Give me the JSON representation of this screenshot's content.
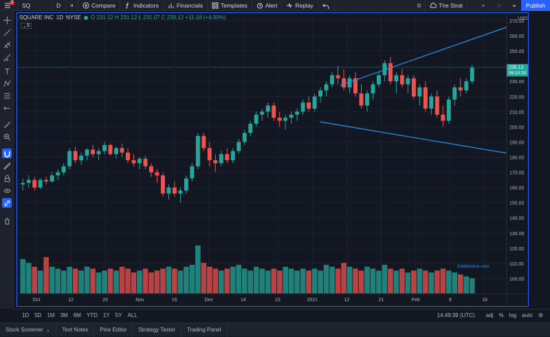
{
  "toolbar": {
    "symbol": "SQ",
    "interval": "D",
    "compare": "Compare",
    "indicators": "Indicators",
    "financials": "Financials",
    "templates": "Templates",
    "alert": "Alert",
    "replay": "Replay",
    "layout_name": "The Strat",
    "publish": "Publish",
    "notification_count": "7"
  },
  "legend": {
    "title": "SQUARE INC",
    "interval": "1D",
    "exchange": "NYSE",
    "ohlc": "O 231.12 H 231.12 L 231.07 C 239.12 +11.18 (+4.90%)",
    "collapsed_label": "S"
  },
  "price_axis": {
    "currency": "USD",
    "ticks": [
      "270.00",
      "260.00",
      "250.00",
      "240.00",
      "230.00",
      "220.00",
      "210.00",
      "200.00",
      "190.00",
      "180.00",
      "170.00",
      "160.00",
      "150.00",
      "140.00",
      "130.00",
      "120.00",
      "110.00",
      "100.00"
    ],
    "last_price": "239.12",
    "countdown": "06:10:20"
  },
  "time_axis": {
    "ticks": [
      "Oct",
      "12",
      "20",
      "Nov",
      "16",
      "Dec",
      "14",
      "22",
      "2021",
      "12",
      "21",
      "Feb",
      "9",
      "18"
    ]
  },
  "watermark": "Criddelsine.com",
  "bottom": {
    "timeframes": [
      "1D",
      "5D",
      "1M",
      "3M",
      "6M",
      "YTD",
      "1Y",
      "5Y",
      "ALL"
    ],
    "clock": "14:49:39 (UTC)",
    "adj": "adj",
    "percent": "%",
    "log": "log",
    "auto": "auto"
  },
  "tabs": [
    "Stock Screener",
    "Text Notes",
    "Pine Editor",
    "Strategy Tester",
    "Trading Panel"
  ],
  "colors": {
    "up": "#26a69a",
    "down": "#ef5350",
    "trendline": "#2196f3",
    "accent": "#2962ff"
  },
  "chart_data": {
    "type": "candlestick",
    "ylim": [
      90,
      275
    ],
    "candles": [
      [
        162,
        166,
        158,
        163
      ],
      [
        163,
        168,
        160,
        165
      ],
      [
        165,
        167,
        158,
        160
      ],
      [
        160,
        166,
        159,
        165
      ],
      [
        165,
        167,
        162,
        164
      ],
      [
        164,
        170,
        163,
        168
      ],
      [
        168,
        172,
        165,
        170
      ],
      [
        170,
        176,
        168,
        174
      ],
      [
        174,
        186,
        172,
        184
      ],
      [
        184,
        187,
        176,
        178
      ],
      [
        178,
        183,
        175,
        181
      ],
      [
        181,
        186,
        178,
        185
      ],
      [
        185,
        188,
        180,
        182
      ],
      [
        182,
        186,
        178,
        184
      ],
      [
        184,
        190,
        182,
        188
      ],
      [
        188,
        189,
        181,
        182
      ],
      [
        182,
        187,
        179,
        186
      ],
      [
        186,
        189,
        180,
        183
      ],
      [
        183,
        186,
        176,
        178
      ],
      [
        178,
        182,
        174,
        176
      ],
      [
        176,
        180,
        172,
        179
      ],
      [
        179,
        181,
        172,
        174
      ],
      [
        174,
        176,
        167,
        170
      ],
      [
        170,
        172,
        163,
        168
      ],
      [
        168,
        170,
        154,
        156
      ],
      [
        156,
        162,
        152,
        160
      ],
      [
        160,
        164,
        154,
        156
      ],
      [
        156,
        160,
        150,
        158
      ],
      [
        158,
        168,
        156,
        166
      ],
      [
        166,
        176,
        164,
        174
      ],
      [
        174,
        196,
        172,
        194
      ],
      [
        194,
        196,
        184,
        186
      ],
      [
        186,
        190,
        174,
        178
      ],
      [
        178,
        182,
        170,
        176
      ],
      [
        176,
        184,
        174,
        182
      ],
      [
        182,
        186,
        176,
        178
      ],
      [
        178,
        186,
        176,
        184
      ],
      [
        184,
        192,
        182,
        190
      ],
      [
        190,
        198,
        188,
        196
      ],
      [
        196,
        204,
        194,
        202
      ],
      [
        202,
        210,
        200,
        208
      ],
      [
        208,
        212,
        204,
        210
      ],
      [
        210,
        216,
        206,
        214
      ],
      [
        214,
        216,
        204,
        206
      ],
      [
        206,
        210,
        200,
        204
      ],
      [
        204,
        208,
        198,
        206
      ],
      [
        206,
        210,
        202,
        208
      ],
      [
        208,
        212,
        204,
        210
      ],
      [
        210,
        218,
        208,
        216
      ],
      [
        216,
        220,
        210,
        212
      ],
      [
        212,
        222,
        210,
        220
      ],
      [
        220,
        226,
        216,
        224
      ],
      [
        224,
        230,
        220,
        228
      ],
      [
        228,
        236,
        226,
        234
      ],
      [
        234,
        240,
        228,
        232
      ],
      [
        232,
        238,
        224,
        226
      ],
      [
        226,
        234,
        222,
        232
      ],
      [
        232,
        236,
        220,
        222
      ],
      [
        222,
        228,
        212,
        214
      ],
      [
        214,
        224,
        210,
        222
      ],
      [
        222,
        230,
        218,
        228
      ],
      [
        228,
        236,
        226,
        234
      ],
      [
        234,
        244,
        230,
        242
      ],
      [
        242,
        246,
        228,
        230
      ],
      [
        230,
        236,
        222,
        234
      ],
      [
        234,
        238,
        226,
        228
      ],
      [
        228,
        234,
        222,
        232
      ],
      [
        232,
        234,
        218,
        220
      ],
      [
        220,
        228,
        214,
        226
      ],
      [
        226,
        230,
        210,
        212
      ],
      [
        212,
        222,
        208,
        220
      ],
      [
        220,
        224,
        206,
        208
      ],
      [
        208,
        214,
        200,
        204
      ],
      [
        204,
        220,
        202,
        218
      ],
      [
        218,
        228,
        214,
        226
      ],
      [
        226,
        232,
        220,
        224
      ],
      [
        224,
        232,
        222,
        230
      ],
      [
        230,
        241,
        228,
        239
      ]
    ],
    "volume": [
      18,
      16,
      14,
      12,
      19,
      14,
      13,
      12,
      14,
      13,
      12,
      14,
      13,
      11,
      12,
      13,
      12,
      14,
      13,
      11,
      12,
      13,
      11,
      12,
      13,
      14,
      13,
      12,
      14,
      15,
      25,
      16,
      14,
      13,
      12,
      13,
      14,
      15,
      13,
      12,
      14,
      13,
      12,
      13,
      12,
      14,
      13,
      12,
      13,
      12,
      13,
      12,
      15,
      14,
      13,
      16,
      14,
      13,
      12,
      14,
      13,
      12,
      15,
      13,
      12,
      13,
      11,
      12,
      13,
      12,
      11,
      12,
      13,
      12,
      11,
      10,
      9,
      8
    ],
    "trendline_upper": [
      [
        470,
        105
      ],
      [
        725,
        16
      ]
    ],
    "trendline_lower": [
      [
        440,
        158
      ],
      [
        768,
        213
      ]
    ]
  }
}
